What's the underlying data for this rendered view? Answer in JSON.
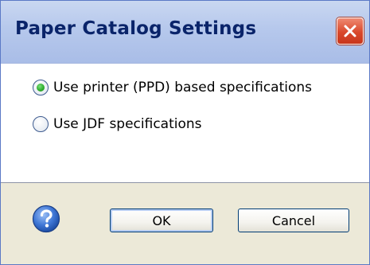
{
  "window": {
    "title": "Paper Catalog Settings",
    "close_icon": "close-x-icon"
  },
  "options": [
    {
      "label": "Use printer (PPD) based specifications",
      "selected": true
    },
    {
      "label": "Use JDF specifications",
      "selected": false
    }
  ],
  "footer": {
    "help_icon": "help-question-icon",
    "ok_label": "OK",
    "cancel_label": "Cancel"
  },
  "colors": {
    "title_text": "#0a246a",
    "titlebar": "#b6c8ec",
    "close_button": "#d9482b",
    "radio_selected": "#2fae2f",
    "footer_bg": "#ece9d8",
    "help_icon": "#2f63c6"
  }
}
